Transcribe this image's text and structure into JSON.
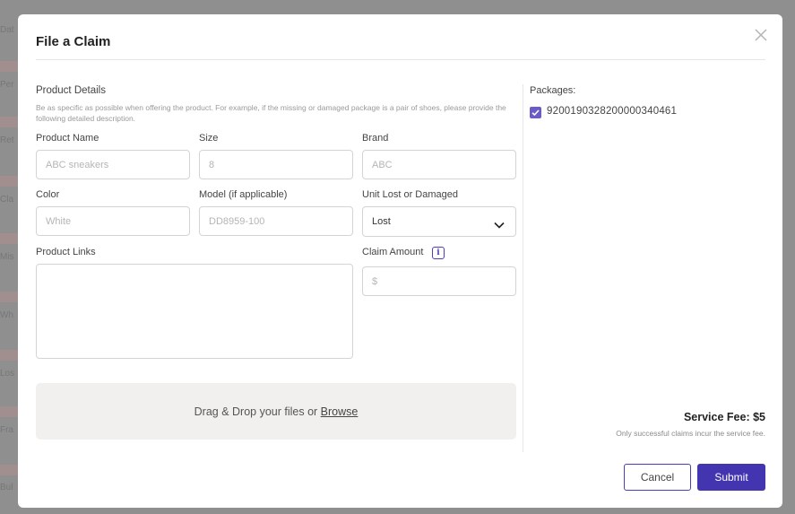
{
  "background": {
    "strips": [
      "Dat",
      "Per",
      "Ret",
      "Cla",
      "Mis",
      "Wh",
      "Los",
      "Fra",
      "Bul"
    ]
  },
  "modal": {
    "title": "File a Claim"
  },
  "product": {
    "section_title": "Product Details",
    "helper": "Be as specific as possible when offering the product. For example, if the missing or damaged package is a pair of shoes, please provide the following detailed description.",
    "name_label": "Product Name",
    "name_placeholder": "ABC sneakers",
    "size_label": "Size",
    "size_placeholder": "8",
    "brand_label": "Brand",
    "brand_placeholder": "ABC",
    "color_label": "Color",
    "color_placeholder": "White",
    "model_label": "Model (if applicable)",
    "model_placeholder": "DD8959-100",
    "unit_label": "Unit Lost or Damaged",
    "unit_value": "Lost",
    "links_label": "Product Links",
    "claim_label": "Claim Amount",
    "claim_placeholder": "$"
  },
  "dropzone": {
    "text": "Drag & Drop your files or ",
    "link": "Browse"
  },
  "packages": {
    "label": "Packages:",
    "items": [
      "92001903282000003404​61"
    ]
  },
  "fee": {
    "title": "Service Fee: $5",
    "note": "Only successful claims incur the service fee."
  },
  "buttons": {
    "cancel": "Cancel",
    "submit": "Submit"
  },
  "colors": {
    "accent": "#4334b0",
    "checkbox": "#6a5bc7"
  }
}
